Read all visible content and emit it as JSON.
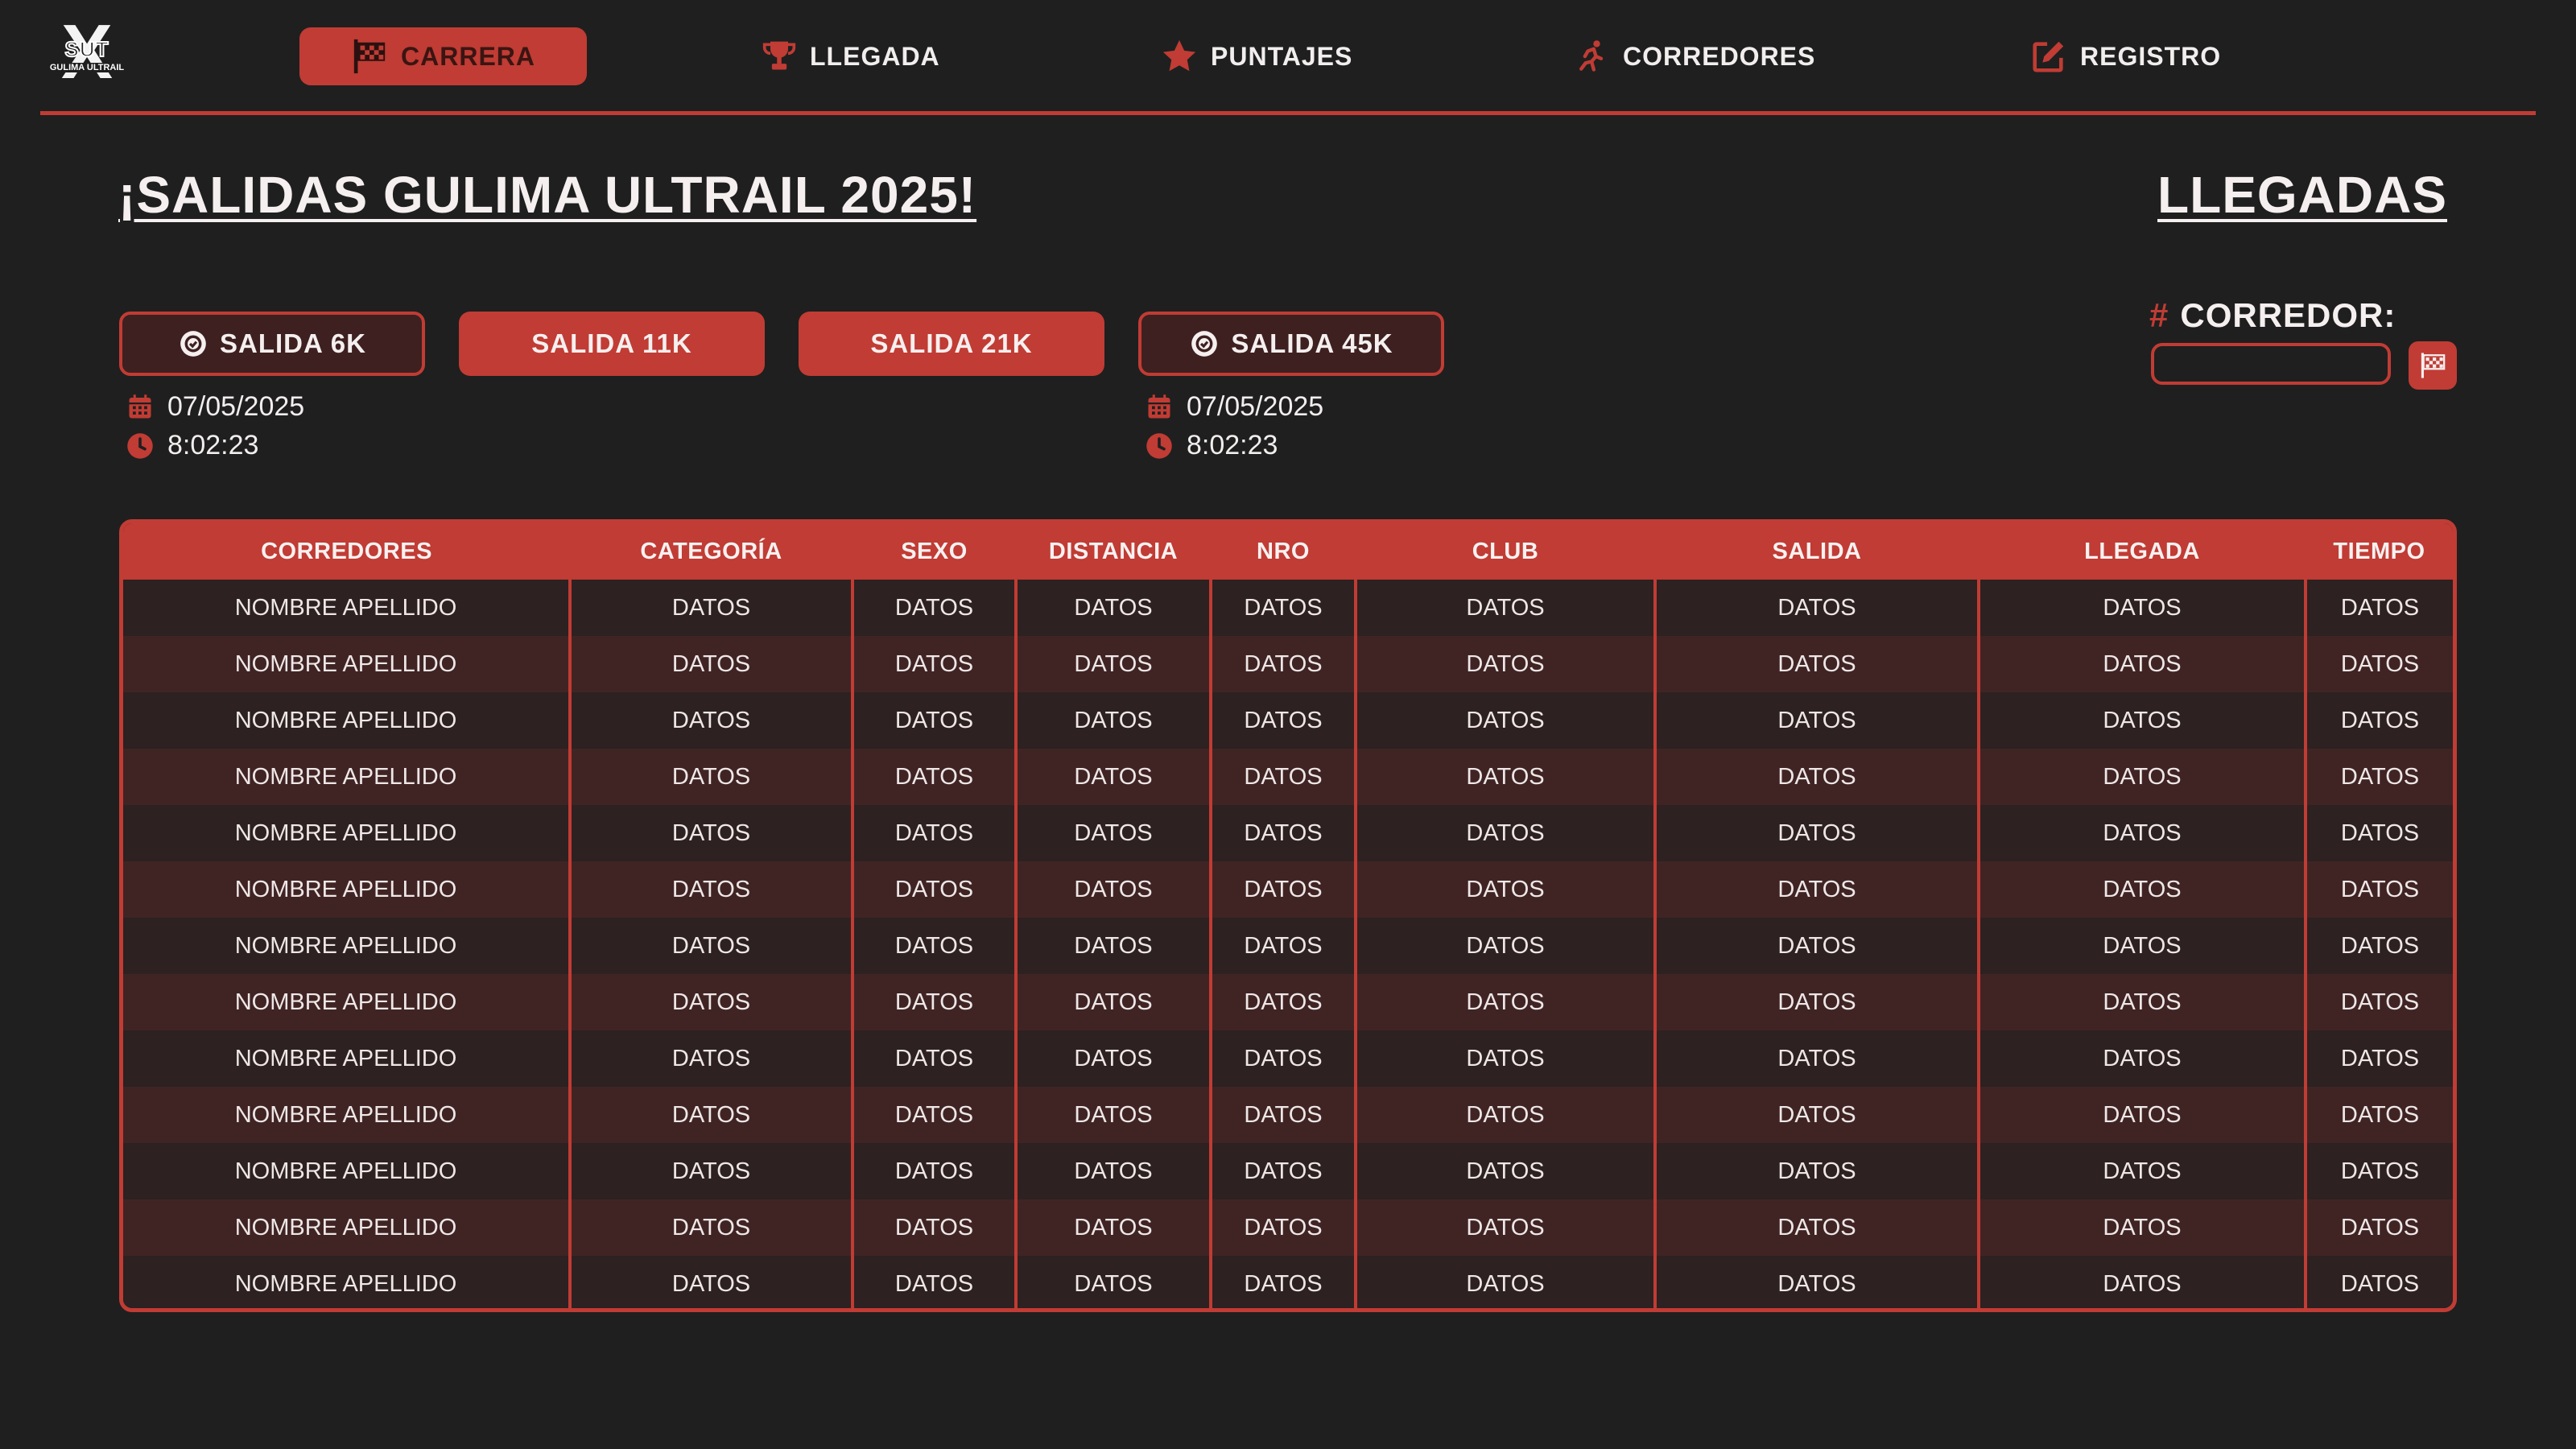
{
  "logo": {
    "mark": "X",
    "letters": "SUT",
    "subtitle": "GULIMA ULTRAIL"
  },
  "nav": {
    "items": [
      {
        "label": "CARRERA",
        "icon": "checkered-flag-icon",
        "active": true
      },
      {
        "label": "LLEGADA",
        "icon": "trophy-icon",
        "active": false
      },
      {
        "label": "PUNTAJES",
        "icon": "star-icon",
        "active": false
      },
      {
        "label": "CORREDORES",
        "icon": "runner-icon",
        "active": false
      },
      {
        "label": "REGISTRO",
        "icon": "edit-icon",
        "active": false
      }
    ]
  },
  "main": {
    "title": "¡SALIDAS GULIMA ULTRAIL 2025!",
    "right_title": "LLEGADAS"
  },
  "starts": [
    {
      "label": "SALIDA 6K",
      "icon": "check-circle-icon",
      "style": "outline",
      "date": "07/05/2025",
      "time": "8:02:23"
    },
    {
      "label": "SALIDA 11K",
      "style": "solid"
    },
    {
      "label": "SALIDA 21K",
      "style": "solid"
    },
    {
      "label": "SALIDA 45K",
      "icon": "check-circle-icon",
      "style": "outline",
      "date": "07/05/2025",
      "time": "8:02:23"
    }
  ],
  "runner_search": {
    "hash": "#",
    "label": "CORREDOR:",
    "value": "",
    "button_icon": "checkered-flag-icon"
  },
  "table": {
    "columns": [
      "CORREDORES",
      "CATEGORÍA",
      "SEXO",
      "DISTANCIA",
      "NRO",
      "CLUB",
      "SALIDA",
      "LLEGADA",
      "TIEMPO"
    ],
    "rows": [
      [
        "NOMBRE APELLIDO",
        "DATOS",
        "DATOS",
        "DATOS",
        "DATOS",
        "DATOS",
        "DATOS",
        "DATOS",
        "DATOS"
      ],
      [
        "NOMBRE APELLIDO",
        "DATOS",
        "DATOS",
        "DATOS",
        "DATOS",
        "DATOS",
        "DATOS",
        "DATOS",
        "DATOS"
      ],
      [
        "NOMBRE APELLIDO",
        "DATOS",
        "DATOS",
        "DATOS",
        "DATOS",
        "DATOS",
        "DATOS",
        "DATOS",
        "DATOS"
      ],
      [
        "NOMBRE APELLIDO",
        "DATOS",
        "DATOS",
        "DATOS",
        "DATOS",
        "DATOS",
        "DATOS",
        "DATOS",
        "DATOS"
      ],
      [
        "NOMBRE APELLIDO",
        "DATOS",
        "DATOS",
        "DATOS",
        "DATOS",
        "DATOS",
        "DATOS",
        "DATOS",
        "DATOS"
      ],
      [
        "NOMBRE APELLIDO",
        "DATOS",
        "DATOS",
        "DATOS",
        "DATOS",
        "DATOS",
        "DATOS",
        "DATOS",
        "DATOS"
      ],
      [
        "NOMBRE APELLIDO",
        "DATOS",
        "DATOS",
        "DATOS",
        "DATOS",
        "DATOS",
        "DATOS",
        "DATOS",
        "DATOS"
      ],
      [
        "NOMBRE APELLIDO",
        "DATOS",
        "DATOS",
        "DATOS",
        "DATOS",
        "DATOS",
        "DATOS",
        "DATOS",
        "DATOS"
      ],
      [
        "NOMBRE APELLIDO",
        "DATOS",
        "DATOS",
        "DATOS",
        "DATOS",
        "DATOS",
        "DATOS",
        "DATOS",
        "DATOS"
      ],
      [
        "NOMBRE APELLIDO",
        "DATOS",
        "DATOS",
        "DATOS",
        "DATOS",
        "DATOS",
        "DATOS",
        "DATOS",
        "DATOS"
      ],
      [
        "NOMBRE APELLIDO",
        "DATOS",
        "DATOS",
        "DATOS",
        "DATOS",
        "DATOS",
        "DATOS",
        "DATOS",
        "DATOS"
      ],
      [
        "NOMBRE APELLIDO",
        "DATOS",
        "DATOS",
        "DATOS",
        "DATOS",
        "DATOS",
        "DATOS",
        "DATOS",
        "DATOS"
      ],
      [
        "NOMBRE APELLIDO",
        "DATOS",
        "DATOS",
        "DATOS",
        "DATOS",
        "DATOS",
        "DATOS",
        "DATOS",
        "DATOS"
      ]
    ]
  },
  "colors": {
    "accent": "#c03c34",
    "background": "#1f1f1f",
    "row_odd": "#2d2121",
    "row_even": "#402424"
  }
}
